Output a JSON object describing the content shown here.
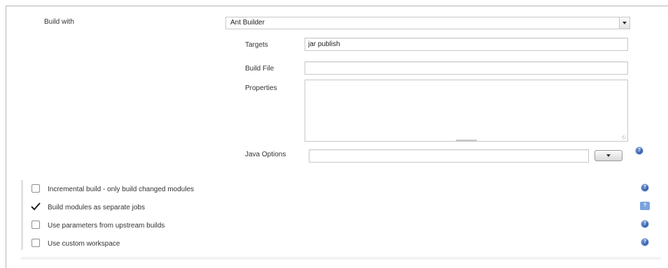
{
  "build": {
    "label": "Build with",
    "selected": "Ant Builder"
  },
  "fields": {
    "targets_label": "Targets",
    "targets_value": "jar publish",
    "build_file_label": "Build File",
    "build_file_value": "",
    "properties_label": "Properties",
    "java_options_label": "Java Options",
    "java_options_value": ""
  },
  "options": [
    {
      "label": "Incremental build - only build changed modules",
      "checked": false
    },
    {
      "label": "Build modules as separate jobs",
      "checked": true
    },
    {
      "label": "Use parameters from upstream builds",
      "checked": false
    },
    {
      "label": "Use custom workspace",
      "checked": false
    }
  ],
  "icons": {
    "help": "help-icon",
    "dropdown": "chevron-down-icon",
    "check": "checkmark-icon"
  },
  "colors": {
    "help_icon": "#1f4a96",
    "help_highlight": "#7aa3dd",
    "border": "#c8c8c8"
  }
}
